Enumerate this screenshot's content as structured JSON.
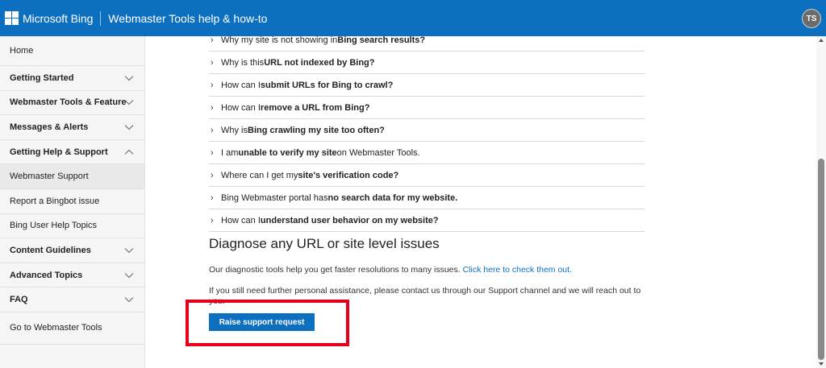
{
  "header": {
    "brand": "Microsoft Bing",
    "title": "Webmaster Tools help & how-to",
    "avatar_initials": "TS",
    "color": "#0d6fbf"
  },
  "sidebar": {
    "items": [
      {
        "label": "Home",
        "type": "link"
      },
      {
        "label": "Getting Started",
        "type": "section",
        "expanded": false
      },
      {
        "label": "Webmaster Tools & Feature",
        "type": "section",
        "expanded": false
      },
      {
        "label": "Messages & Alerts",
        "type": "section",
        "expanded": false
      },
      {
        "label": "Getting Help & Support",
        "type": "section",
        "expanded": true
      },
      {
        "label": "Webmaster Support",
        "type": "link",
        "active": true
      },
      {
        "label": "Report a Bingbot issue",
        "type": "link"
      },
      {
        "label": "Bing User Help Topics",
        "type": "link"
      },
      {
        "label": "Content Guidelines",
        "type": "section",
        "expanded": false
      },
      {
        "label": "Advanced Topics",
        "type": "section",
        "expanded": false
      },
      {
        "label": "FAQ",
        "type": "section",
        "expanded": false
      },
      {
        "label": "Go to Webmaster Tools",
        "type": "link"
      }
    ]
  },
  "faq": {
    "items": [
      {
        "pre": "Why my site is not showing in ",
        "bold": "Bing search results?",
        "post": ""
      },
      {
        "pre": "Why is this ",
        "bold": "URL not indexed by Bing?",
        "post": ""
      },
      {
        "pre": "How can I ",
        "bold": "submit URLs for Bing to crawl?",
        "post": ""
      },
      {
        "pre": "How can I ",
        "bold": "remove a URL from Bing?",
        "post": ""
      },
      {
        "pre": "Why is ",
        "bold": "Bing crawling my site too often?",
        "post": ""
      },
      {
        "pre": "I am ",
        "bold": "unable to verify my site",
        "post": " on Webmaster Tools."
      },
      {
        "pre": "Where can I get my ",
        "bold": "site's verification code?",
        "post": ""
      },
      {
        "pre": "Bing Webmaster portal has ",
        "bold": "no search data for my website.",
        "post": ""
      },
      {
        "pre": "How can I ",
        "bold": "understand user behavior on my website?",
        "post": ""
      }
    ]
  },
  "diagnose": {
    "heading": "Diagnose any URL or site level issues",
    "text": "Our diagnostic tools help you get faster resolutions to many issues. ",
    "link": "Click here to check them out.",
    "assist_text": "If you still need further personal assistance, please contact us through our Support channel and we will reach out to you.",
    "button_label": "Raise support request"
  },
  "colors": {
    "accent": "#0d6fbf",
    "highlight": "#e8001a"
  }
}
